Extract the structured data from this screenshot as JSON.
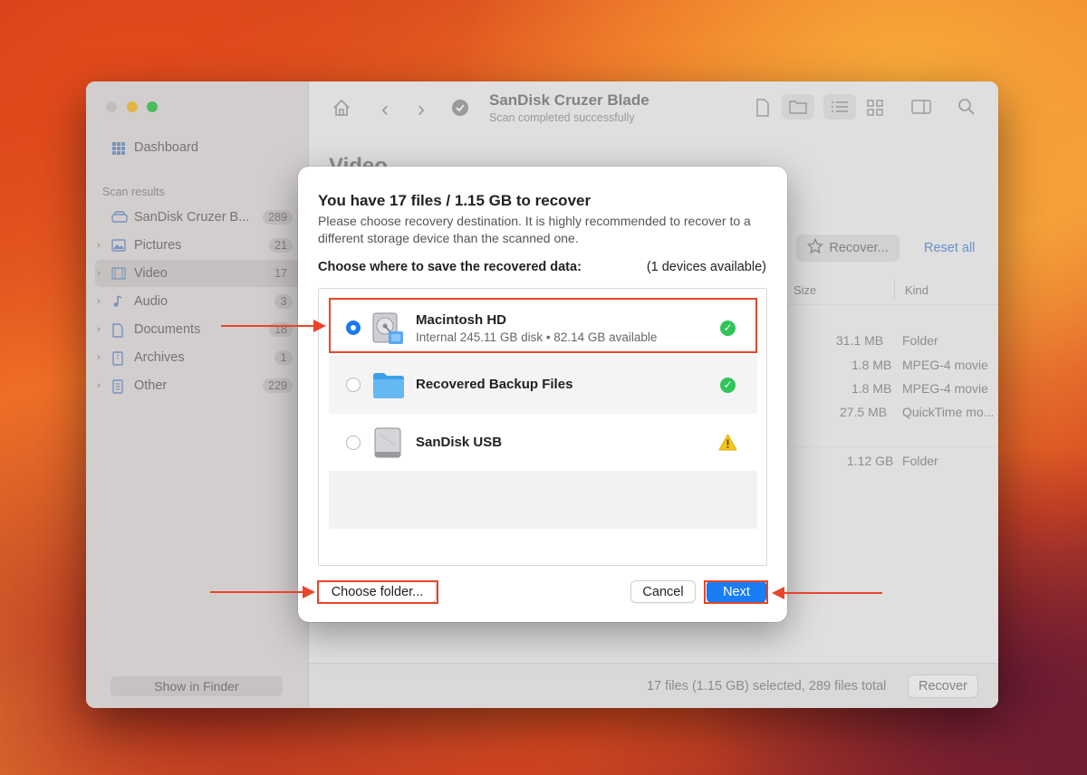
{
  "window": {
    "title": "SanDisk Cruzer Blade",
    "subtitle": "Scan completed successfully"
  },
  "sidebar": {
    "dashboard_label": "Dashboard",
    "section_label": "Scan results",
    "items": [
      {
        "label": "SanDisk Cruzer B...",
        "count": "289",
        "icon": "drive-icon"
      },
      {
        "label": "Pictures",
        "count": "21",
        "icon": "pictures-icon"
      },
      {
        "label": "Video",
        "count": "17",
        "icon": "video-icon"
      },
      {
        "label": "Audio",
        "count": "3",
        "icon": "audio-icon"
      },
      {
        "label": "Documents",
        "count": "18",
        "icon": "documents-icon"
      },
      {
        "label": "Archives",
        "count": "1",
        "icon": "archives-icon"
      },
      {
        "label": "Other",
        "count": "229",
        "icon": "other-icon"
      }
    ],
    "show_in_finder": "Show in Finder"
  },
  "main": {
    "heading": "Video",
    "recover_button": "Recover...",
    "reset_all": "Reset all",
    "columns": {
      "size": "Size",
      "kind": "Kind"
    },
    "rows": [
      {
        "size": "31.1 MB",
        "kind": "Folder"
      },
      {
        "size": "1.8 MB",
        "kind": "MPEG-4 movie"
      },
      {
        "size": "1.8 MB",
        "kind": "MPEG-4 movie"
      },
      {
        "size": "27.5 MB",
        "kind": "QuickTime mo..."
      },
      {
        "size": "1.12 GB",
        "kind": "Folder"
      }
    ],
    "footer_status": "17 files (1.15 GB) selected, 289 files total",
    "footer_recover": "Recover"
  },
  "dialog": {
    "title": "You have 17 files / 1.15 GB to recover",
    "description": "Please choose recovery destination. It is highly recommended to recover to a different storage device than the scanned one.",
    "choose_label": "Choose where to save the recovered data:",
    "available": "(1 devices available)",
    "devices": [
      {
        "name": "Macintosh HD",
        "detail": "Internal 245.11 GB disk • 82.14 GB available",
        "selected": true,
        "status": "ok"
      },
      {
        "name": "Recovered Backup Files",
        "detail": "",
        "selected": false,
        "status": "ok"
      },
      {
        "name": "SanDisk USB",
        "detail": "",
        "selected": false,
        "status": "warning"
      }
    ],
    "choose_folder": "Choose folder...",
    "cancel": "Cancel",
    "next": "Next"
  },
  "colors": {
    "accent": "#1a7df3",
    "annotation": "#e8452a",
    "ok": "#30c45a",
    "warning": "#f5c518"
  }
}
